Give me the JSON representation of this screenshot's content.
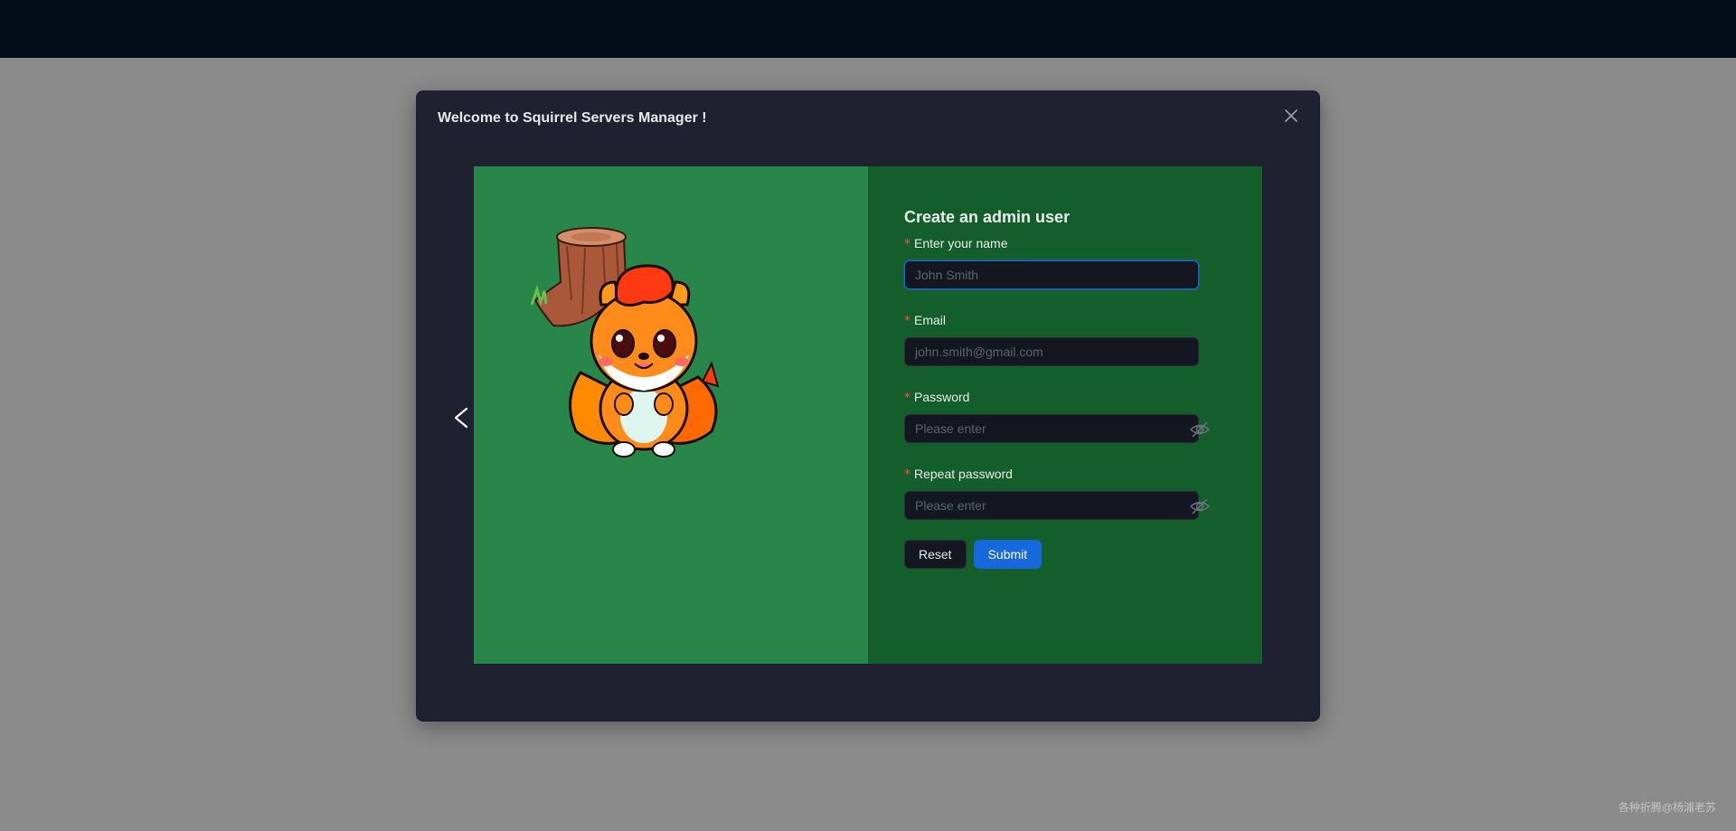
{
  "modal": {
    "title": "Welcome to Squirrel Servers Manager !"
  },
  "form": {
    "title": "Create an admin user",
    "name_label": "Enter your name",
    "name_placeholder": "John Smith",
    "email_label": "Email",
    "email_placeholder": "john.smith@gmail.com",
    "password_label": "Password",
    "password_placeholder": "Please enter",
    "repeat_label": "Repeat password",
    "repeat_placeholder": "Please enter",
    "required_mark": "*",
    "reset_label": "Reset",
    "submit_label": "Submit"
  },
  "icons": {
    "close": "close-icon",
    "prev": "chevron-left-icon",
    "eye": "eye-invisible-icon"
  },
  "colors": {
    "topbar": "#020d19",
    "modal_bg": "#1f2130",
    "left_panel": "#28864b",
    "right_panel": "#135e2b",
    "primary": "#1668dc",
    "required": "#ff4d4f"
  },
  "watermark": "各种折腾@杨浦老苏"
}
